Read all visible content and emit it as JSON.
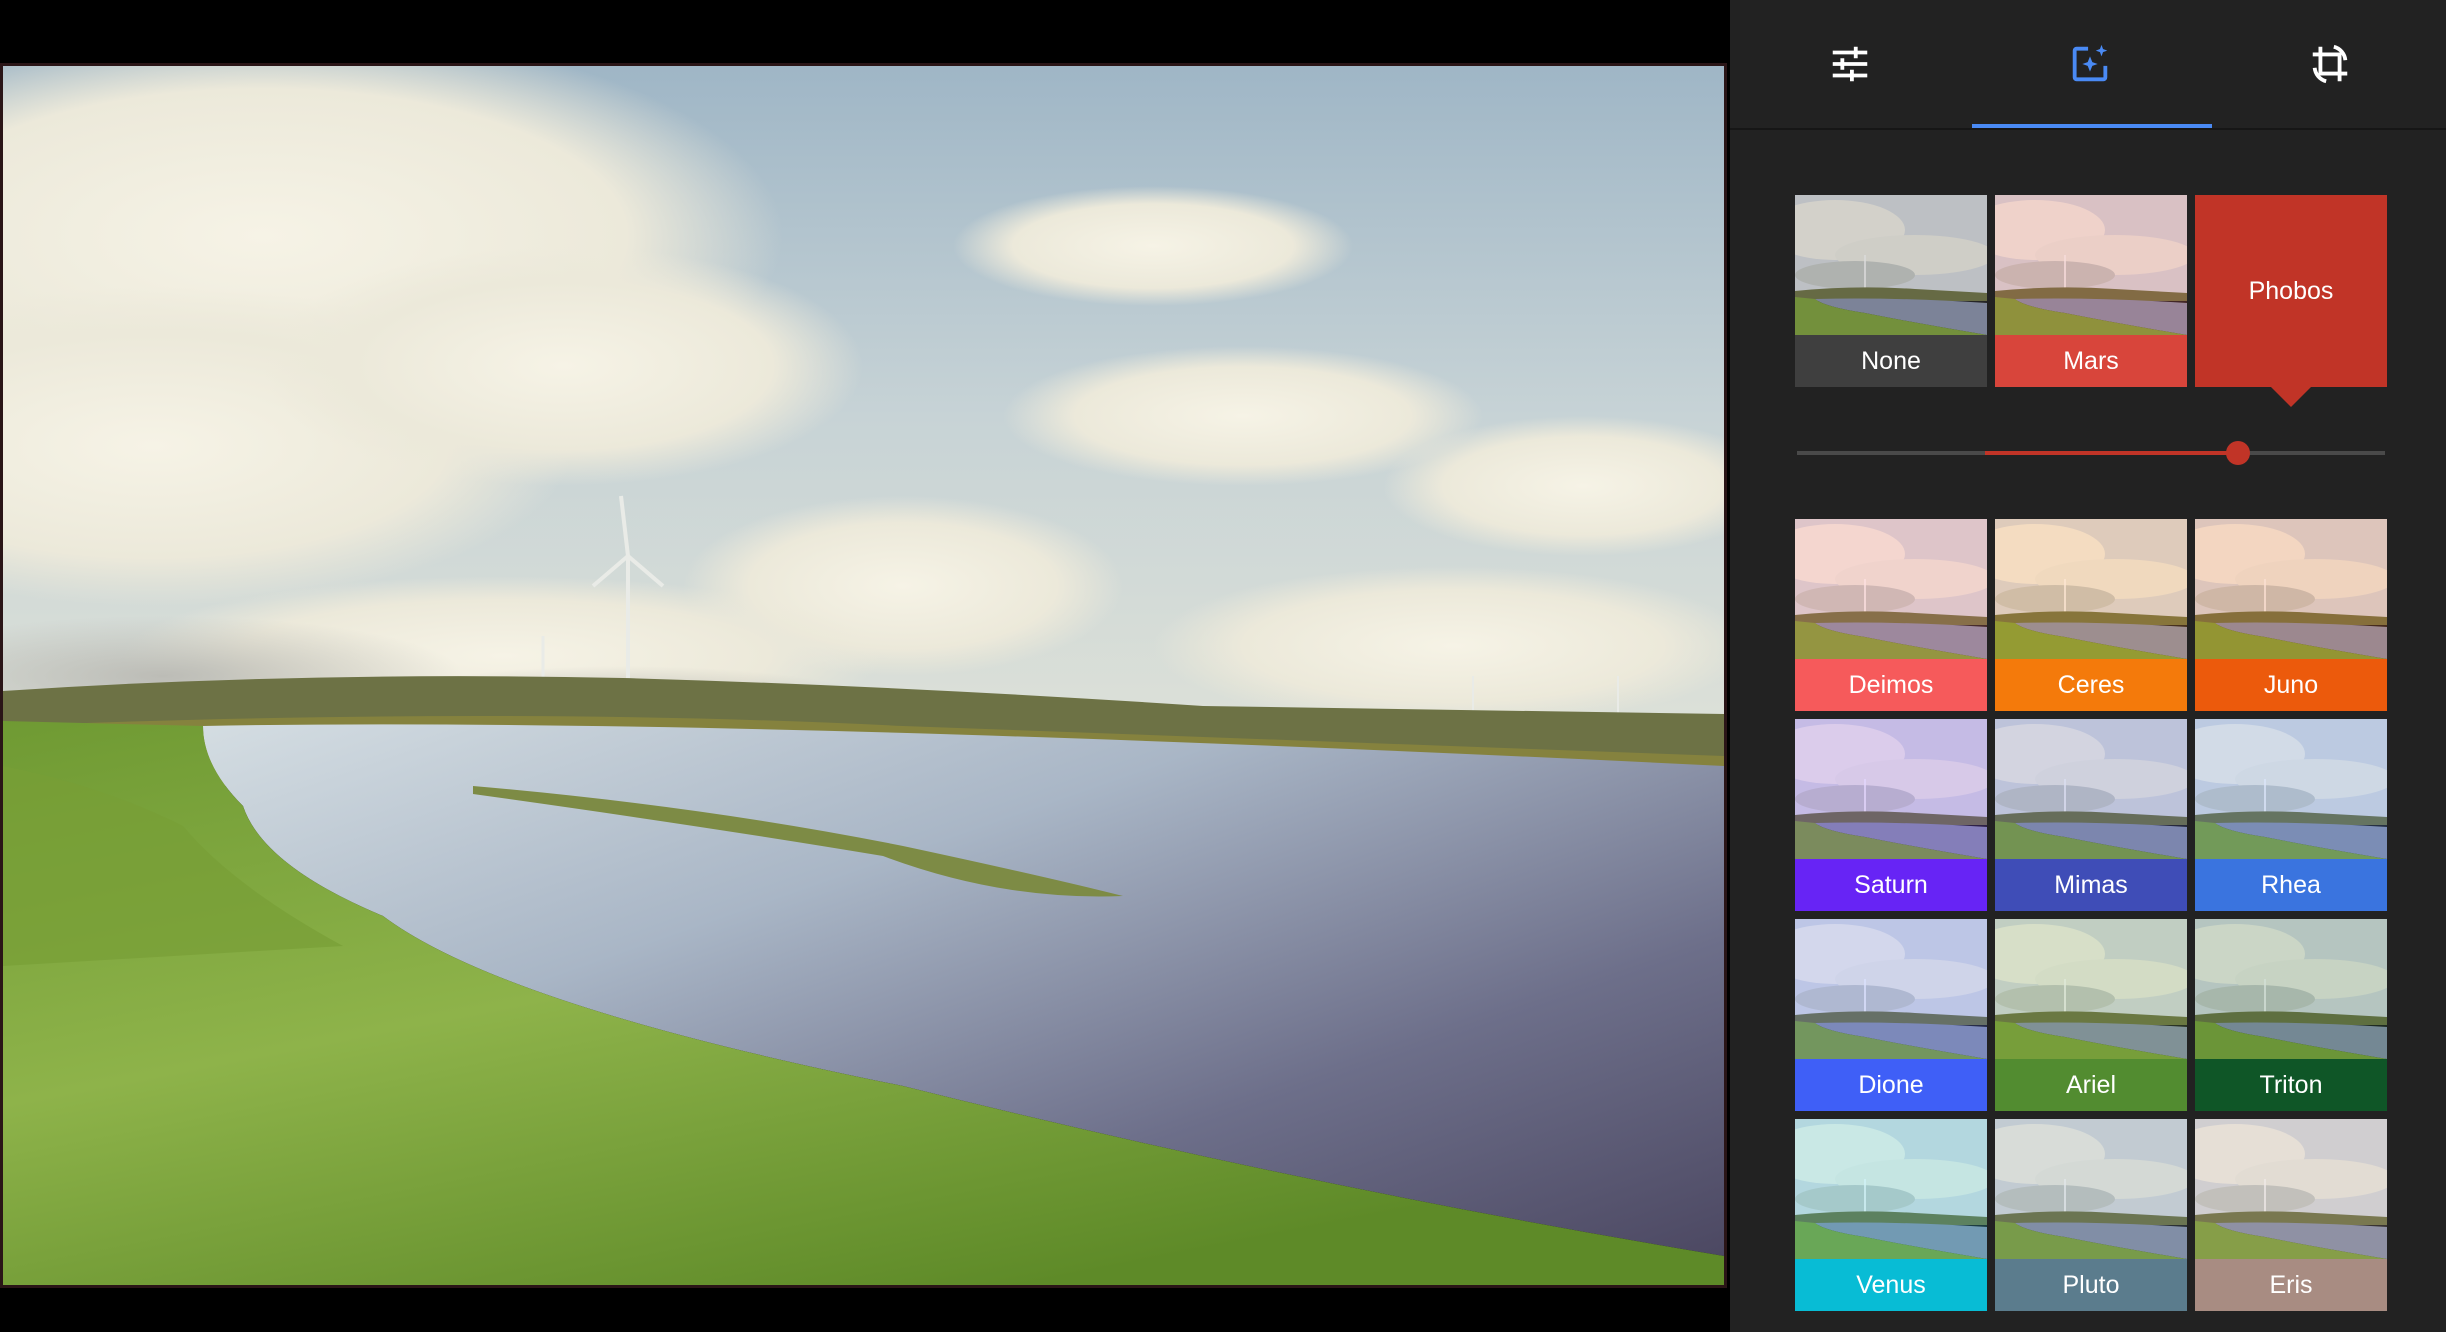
{
  "toolbar": {
    "tabs": [
      {
        "id": "adjust",
        "icon": "sliders-icon",
        "active": false
      },
      {
        "id": "filters",
        "icon": "filters-sparkle-icon",
        "active": true
      },
      {
        "id": "crop",
        "icon": "crop-rotate-icon",
        "active": false
      }
    ],
    "accent": "#4a8af4",
    "icon_color": "#ffffff"
  },
  "selected_filter": {
    "label": "Phobos",
    "color": "#c13427",
    "intensity": 0.75
  },
  "filters_top": [
    {
      "label": "None",
      "color": "#3f3f3f"
    },
    {
      "label": "Mars",
      "color": "#d8453b"
    },
    {
      "label": "Phobos",
      "color": "#c13427"
    }
  ],
  "filters_grid": [
    {
      "label": "Deimos",
      "color": "#f65a5b"
    },
    {
      "label": "Ceres",
      "color": "#f47a0b"
    },
    {
      "label": "Juno",
      "color": "#ec5a0c"
    },
    {
      "label": "Saturn",
      "color": "#6724f5"
    },
    {
      "label": "Mimas",
      "color": "#3f4db7"
    },
    {
      "label": "Rhea",
      "color": "#3a74df"
    },
    {
      "label": "Dione",
      "color": "#3f5ff7"
    },
    {
      "label": "Ariel",
      "color": "#528c30"
    },
    {
      "label": "Triton",
      "color": "#0f5627"
    },
    {
      "label": "Venus",
      "color": "#08bcd5"
    },
    {
      "label": "Pluto",
      "color": "#5b7c8d"
    },
    {
      "label": "Eris",
      "color": "#a88c82"
    }
  ]
}
